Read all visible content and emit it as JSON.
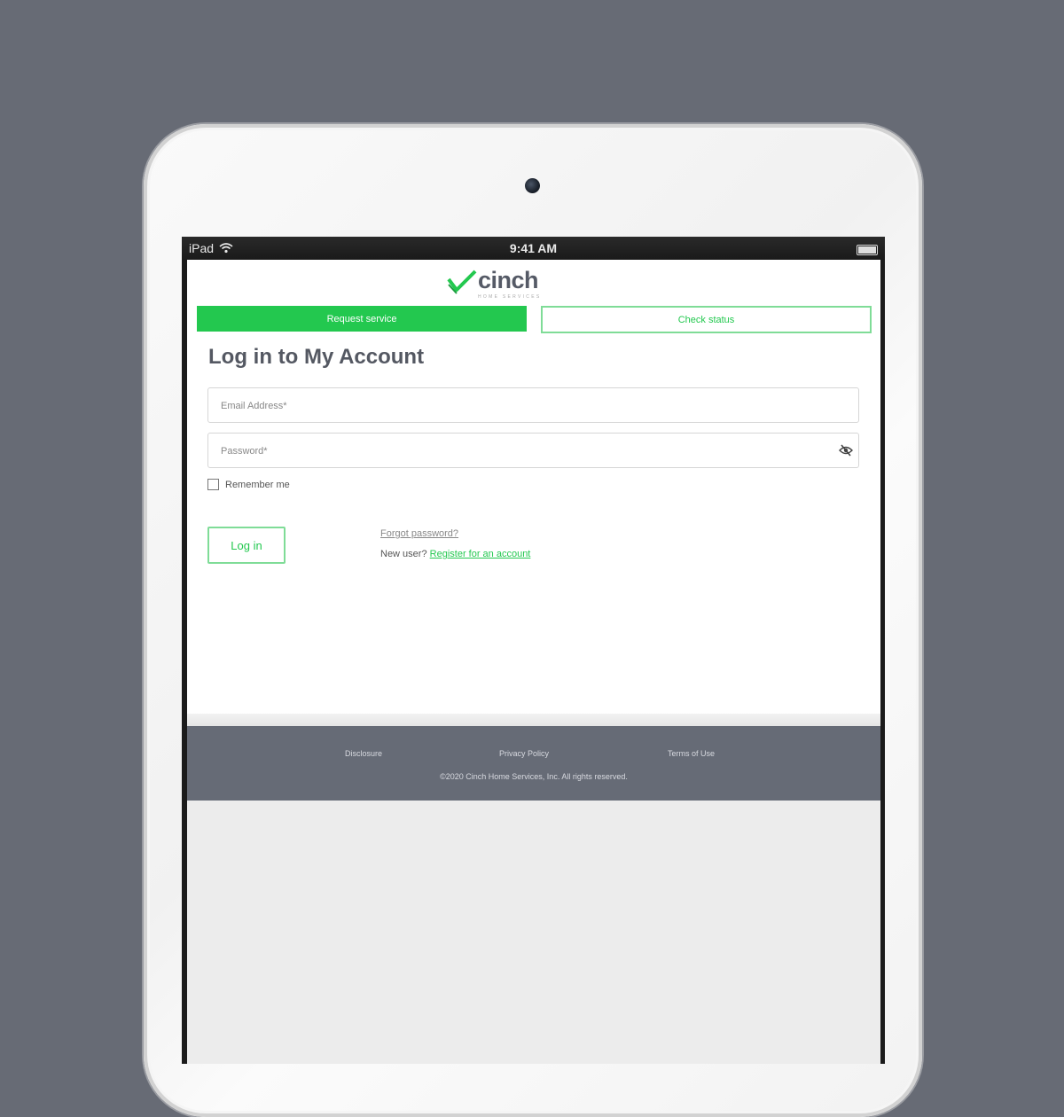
{
  "status_bar": {
    "device": "iPad",
    "time": "9:41 AM"
  },
  "brand": {
    "name": "cinch",
    "tagline": "HOME SERVICES",
    "accent": "#23c84f"
  },
  "actions": {
    "request_service": "Request service",
    "check_status": "Check status"
  },
  "login": {
    "title": "Log in to My Account",
    "email_placeholder": "Email Address*",
    "password_placeholder": "Password*",
    "remember_label": "Remember me",
    "remember_checked": false,
    "login_button": "Log in",
    "forgot_link": "Forgot password?",
    "new_user_text": "New user?",
    "register_link": "Register for an account"
  },
  "footer": {
    "links": [
      "Disclosure",
      "Privacy Policy",
      "Terms of Use"
    ],
    "copyright": "©2020 Cinch Home Services, Inc. All rights reserved."
  },
  "icons": {
    "wifi": "wifi-icon",
    "battery": "battery-icon",
    "logo_check": "checkmark-icon",
    "password_toggle": "eye-slash-icon",
    "camera": "camera-icon"
  },
  "colors": {
    "background": "#676b75",
    "footer_bg": "#666b76",
    "title_text": "#545862"
  }
}
